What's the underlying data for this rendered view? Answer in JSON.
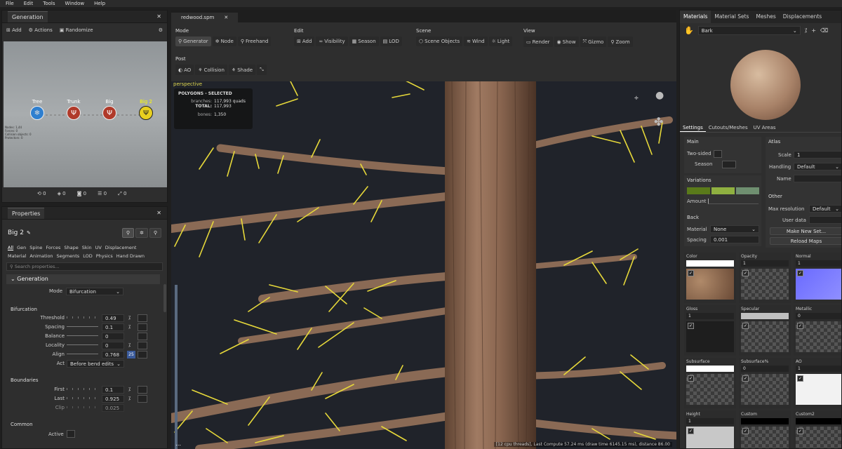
{
  "menu": [
    "File",
    "Edit",
    "Tools",
    "Window",
    "Help"
  ],
  "generation": {
    "title": "Generation",
    "add": "Add",
    "actions": "Actions",
    "randomize": "Randomize",
    "nodes": [
      {
        "label": "Tree",
        "color": "#2f7fcf"
      },
      {
        "label": "Trunk",
        "color": "#b03a2a"
      },
      {
        "label": "Big",
        "color": "#b03a2a"
      },
      {
        "label": "Big 2",
        "color": "#e8d020"
      }
    ],
    "stats": [
      "Nodes: 1,44",
      "Forces: 0",
      "Collision objects: 0",
      "Protectors: 0"
    ],
    "bottom": [
      "0",
      "0",
      "0",
      "0",
      "0"
    ]
  },
  "properties": {
    "title": "Properties",
    "node_name": "Big 2",
    "tabs1": [
      "All",
      "Gen",
      "Spine",
      "Forces",
      "Shape",
      "Skin",
      "UV",
      "Displacement"
    ],
    "tabs2": [
      "Material",
      "Animation",
      "Segments",
      "LOD",
      "Physics",
      "Hand Drawn"
    ],
    "search_placeholder": "Search properties...",
    "generation": "Generation",
    "mode_label": "Mode",
    "mode_value": "Bifurcation",
    "bifurcation": "Bifurcation",
    "rows": [
      {
        "label": "Threshold",
        "value": "0.49"
      },
      {
        "label": "Spacing",
        "value": "0.1"
      },
      {
        "label": "Balance",
        "value": "0"
      },
      {
        "label": "Locality",
        "value": "0"
      },
      {
        "label": "Align",
        "value": "0.768",
        "extra": "25"
      }
    ],
    "act_label": "Act",
    "act_value": "Before bend edits",
    "boundaries": "Boundaries",
    "brows": [
      {
        "label": "First",
        "value": "0.1"
      },
      {
        "label": "Last",
        "value": "0.925"
      },
      {
        "label": "Clip",
        "value": "0.025"
      }
    ],
    "common": "Common",
    "active": "Active"
  },
  "doc_tab": "redwood.spm",
  "toolbar": {
    "mode": {
      "h": "Mode",
      "items": [
        "Generator",
        "Node",
        "Freehand"
      ]
    },
    "edit": {
      "h": "Edit",
      "items": [
        "Add",
        "Visibility",
        "Season",
        "LOD"
      ]
    },
    "scene": {
      "h": "Scene",
      "items": [
        "Scene Objects",
        "Wind",
        "Light"
      ]
    },
    "view": {
      "h": "View",
      "items": [
        "Render",
        "Show",
        "Gizmo",
        "Zoom"
      ]
    },
    "post": {
      "h": "Post",
      "items": [
        "AO",
        "Collision",
        "Shade"
      ]
    }
  },
  "viewport": {
    "label": "perspective",
    "sel_title": "POLYGONS - SELECTED",
    "branches_label": "branches:",
    "branches_value": "117,993 quads",
    "total_label": "TOTAL:",
    "total_value": "117,993",
    "bones_label": "bones:",
    "bones_value": "1,350",
    "status": "[12 cpu threads], Last Compute 57.24 ms (draw time 6145.15 ms), distance 86.00"
  },
  "right": {
    "tabs": [
      "Materials",
      "Material Sets",
      "Meshes",
      "Displacements"
    ],
    "material": "Bark",
    "subtabs": [
      "Settings",
      "Cutouts/Meshes",
      "UV Areas"
    ],
    "main": "Main",
    "two_sided": "Two-sided",
    "season": "Season",
    "atlas": "Atlas",
    "scale_label": "Scale",
    "scale_value": "1",
    "handling_label": "Handling",
    "handling_value": "Default",
    "name_label": "Name",
    "variations": "Variations",
    "amount": "Amount",
    "var_colors": [
      "#5a7a1a",
      "#8fb040",
      "#6f8f70"
    ],
    "other": "Other",
    "maxres_label": "Max resolution",
    "maxres_value": "Default",
    "userdata_label": "User data",
    "newset": "Make New Set...",
    "reload": "Reload Maps",
    "back": "Back",
    "material_label": "Material",
    "material_value": "None",
    "spacing_label": "Spacing",
    "spacing_value": "0.001",
    "maps": [
      {
        "name": "Color",
        "val": ""
      },
      {
        "name": "Opacity",
        "val": "1"
      },
      {
        "name": "Normal",
        "val": "1"
      },
      {
        "name": "Gloss",
        "val": "1"
      },
      {
        "name": "Specular",
        "val": ""
      },
      {
        "name": "Metallic",
        "val": "0"
      },
      {
        "name": "Subsurface",
        "val": ""
      },
      {
        "name": "Subsurface%",
        "val": "0"
      },
      {
        "name": "AO",
        "val": "1"
      },
      {
        "name": "Height",
        "val": "1"
      },
      {
        "name": "Custom",
        "val": ""
      },
      {
        "name": "Custom2",
        "val": ""
      }
    ]
  }
}
